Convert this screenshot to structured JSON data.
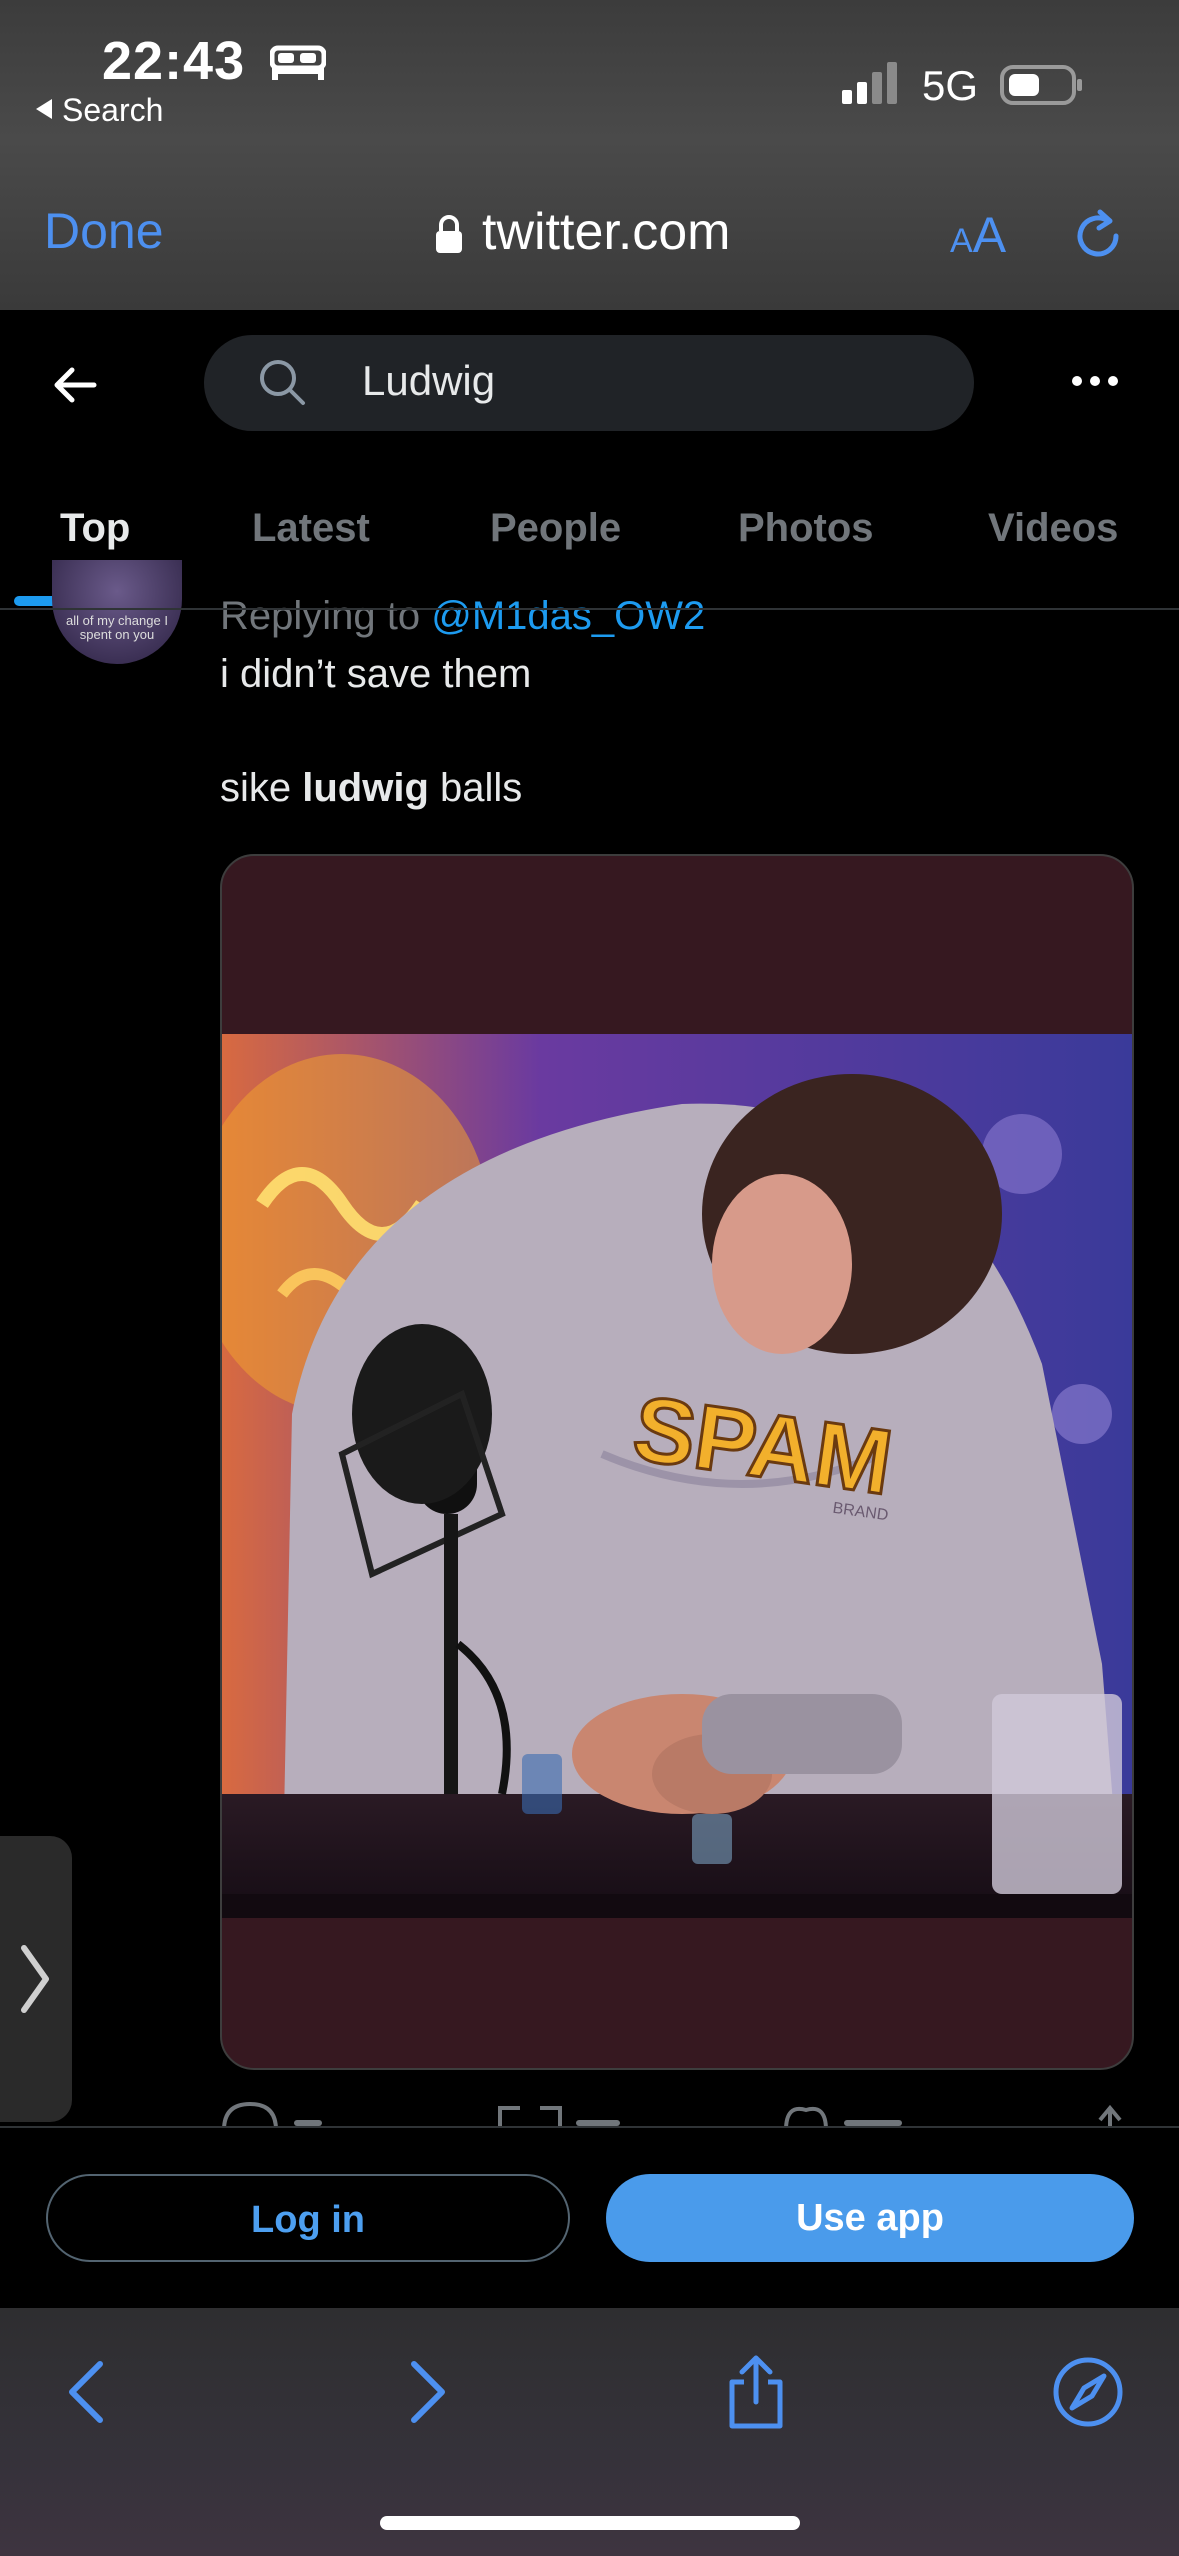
{
  "status_bar": {
    "time": "22:43",
    "back_app": "Search",
    "network": "5G"
  },
  "safari_top": {
    "done_label": "Done",
    "url": "twitter.com",
    "text_size_small": "A",
    "text_size_large": "A"
  },
  "twitter_header": {
    "search_query": "Ludwig"
  },
  "tabs": [
    {
      "label": "Top",
      "active": true
    },
    {
      "label": "Latest",
      "active": false
    },
    {
      "label": "People",
      "active": false
    },
    {
      "label": "Photos",
      "active": false
    },
    {
      "label": "Videos",
      "active": false
    }
  ],
  "tweet": {
    "replying_prefix": "Replying to ",
    "replying_handle": "@M1das_OW2",
    "avatar_text": "all of my change I spent on you",
    "line1": "i didn’t save them",
    "line2_pre": "sike ",
    "line2_bold": "ludwig",
    "line2_post": " balls",
    "media_sweater_text": "SPAM",
    "media_sweater_subtext": "BRAND"
  },
  "login_bar": {
    "login_label": "Log in",
    "use_app_label": "Use app"
  },
  "colors": {
    "accent": "#1d9bf0",
    "safari_blue": "#4d90f0",
    "media_bg": "#361820"
  }
}
